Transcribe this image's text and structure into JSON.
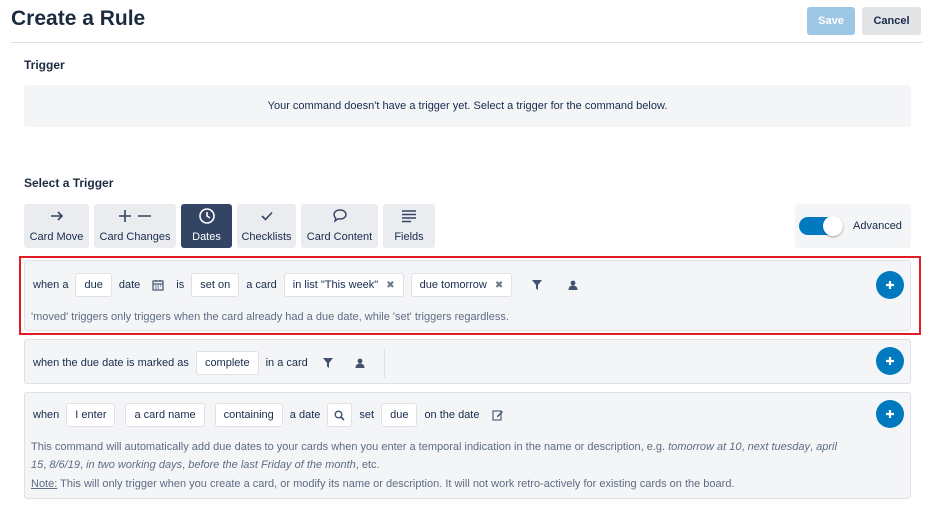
{
  "header": {
    "title": "Create a Rule",
    "save_label": "Save",
    "cancel_label": "Cancel"
  },
  "trigger": {
    "label": "Trigger",
    "empty_message": "Your command doesn't have a trigger yet. Select a trigger for the command below."
  },
  "select_trigger": {
    "label": "Select a Trigger",
    "tabs": [
      {
        "label": "Card Move",
        "icon": "arrow-right-icon"
      },
      {
        "label": "Card Changes",
        "icon": "plus-minus-icon"
      },
      {
        "label": "Dates",
        "icon": "clock-icon",
        "active": true
      },
      {
        "label": "Checklists",
        "icon": "check-icon"
      },
      {
        "label": "Card Content",
        "icon": "speech-bubble-icon"
      },
      {
        "label": "Fields",
        "icon": "lines-icon"
      }
    ],
    "advanced_label": "Advanced",
    "advanced_on": true
  },
  "rules": {
    "r1": {
      "when_a": "when a",
      "due": "due",
      "date": "date",
      "is": "is",
      "set_on": "set on",
      "a_card": "a card",
      "in_list": "in list \"This week\"",
      "due_tomorrow": "due tomorrow",
      "note": "'moved' triggers only triggers when the card already had a due date, while 'set' triggers regardless."
    },
    "r2": {
      "prefix": "when the due date is marked as",
      "complete": "complete",
      "in_a_card": "in a card"
    },
    "r3": {
      "when": "when",
      "i_enter": "I enter",
      "a_card_name": "a card name",
      "containing": "containing",
      "a_date": "a date",
      "set": "set",
      "due": "due",
      "on_the_date": "on the date",
      "desc_plain": "This command will automatically add due dates to your cards when you enter a temporal indication in the name or description, e.g. ",
      "desc_example1": "tomorrow at 10",
      "desc_comma1": ", ",
      "desc_example2": "next tuesday",
      "desc_comma2": ", ",
      "desc_example3": "april 15",
      "desc_comma3": ", ",
      "desc_example4": "8/6/19",
      "desc_comma4": ", ",
      "desc_example5": "in two working days",
      "desc_comma5": ", ",
      "desc_example6": "before the last Friday of the month",
      "desc_end": ", etc.",
      "note_label": "Note:",
      "note_text": " This will only trigger when you create a card, or modify its name or description. It will not work retro-actively for existing cards on the board."
    }
  },
  "colors": {
    "accent": "#0079bf",
    "active_tab": "#344563",
    "highlight": "#e01c24",
    "save_disabled": "#9ec7e6"
  }
}
